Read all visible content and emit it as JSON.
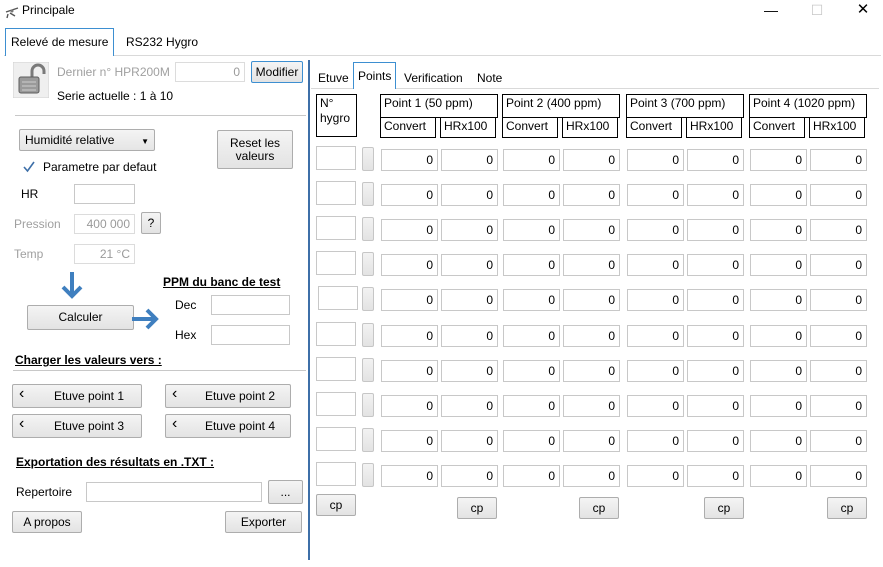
{
  "window": {
    "title": "Principale",
    "controls": [
      "—",
      "☐",
      "✕"
    ]
  },
  "outer_tabs": [
    "Relevé de mesure",
    "RS232 Hygro"
  ],
  "left": {
    "last_no_label": "Dernier n° HPR200M",
    "last_no_value": "0",
    "modifier_label": "Modifier",
    "serie_label": "Serie actuelle : 1 à 10",
    "mode_select": "Humidité relative",
    "reset_label": "Reset les valeurs",
    "default_param_label": "Parametre par defaut",
    "default_param_checked": true,
    "hr_label": "HR",
    "hr_value": "",
    "pression_label": "Pression",
    "pression_value": "400 000",
    "pression_help": "?",
    "temp_label": "Temp",
    "temp_value": "21 °C",
    "calculer_label": "Calculer",
    "ppm_title": "PPM du banc de test",
    "dec_label": "Dec",
    "dec_value": "",
    "hex_label": "Hex",
    "hex_value": "",
    "charger_title": "Charger les valeurs vers :",
    "etuve_buttons": [
      "Etuve point 1",
      "Etuve point 2",
      "Etuve point 3",
      "Etuve point 4"
    ],
    "export_title": "Exportation des résultats en .TXT :",
    "repertoire_label": "Repertoire",
    "repertoire_value": "",
    "browse_label": "...",
    "apropos_label": "A propos",
    "exporter_label": "Exporter"
  },
  "inner_tabs": [
    "Etuve",
    "Points",
    "Verification",
    "Note"
  ],
  "grid": {
    "no_header": "N°\nhygro",
    "points": [
      {
        "title": "Point 1 (50 ppm)",
        "sub": [
          "Convert",
          "HRx100"
        ]
      },
      {
        "title": "Point 2 (400 ppm)",
        "sub": [
          "Convert",
          "HRx100"
        ]
      },
      {
        "title": "Point 3 (700 ppm)",
        "sub": [
          "Convert",
          "HRx100"
        ]
      },
      {
        "title": "Point 4 (1020 ppm)",
        "sub": [
          "Convert",
          "HRx100"
        ]
      }
    ],
    "rows": [
      [
        "0",
        "0",
        "0",
        "0",
        "0",
        "0",
        "0",
        "0"
      ],
      [
        "0",
        "0",
        "0",
        "0",
        "0",
        "0",
        "0",
        "0"
      ],
      [
        "0",
        "0",
        "0",
        "0",
        "0",
        "0",
        "0",
        "0"
      ],
      [
        "0",
        "0",
        "0",
        "0",
        "0",
        "0",
        "0",
        "0"
      ],
      [
        "0",
        "0",
        "0",
        "0",
        "0",
        "0",
        "0",
        "0"
      ],
      [
        "0",
        "0",
        "0",
        "0",
        "0",
        "0",
        "0",
        "0"
      ],
      [
        "0",
        "0",
        "0",
        "0",
        "0",
        "0",
        "0",
        "0"
      ],
      [
        "0",
        "0",
        "0",
        "0",
        "0",
        "0",
        "0",
        "0"
      ],
      [
        "0",
        "0",
        "0",
        "0",
        "0",
        "0",
        "0",
        "0"
      ],
      [
        "0",
        "0",
        "0",
        "0",
        "0",
        "0",
        "0",
        "0"
      ]
    ],
    "cp_label": "cp"
  },
  "colors": {
    "accent": "#3d8fd1",
    "arrow": "#3f7fbf"
  }
}
